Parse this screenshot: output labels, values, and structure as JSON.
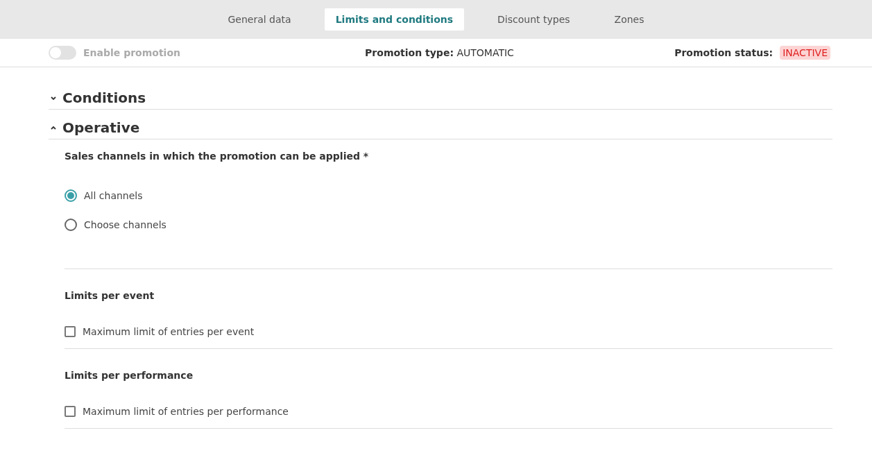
{
  "tabs": [
    {
      "label": "General data",
      "selected": false
    },
    {
      "label": "Limits and conditions",
      "selected": true
    },
    {
      "label": "Discount types",
      "selected": false
    },
    {
      "label": "Zones",
      "selected": false
    }
  ],
  "status_bar": {
    "toggle": {
      "label": "Enable promotion",
      "on": false,
      "disabled": true
    },
    "type_label": "Promotion type:",
    "type_value": "AUTOMATIC",
    "status_label": "Promotion status:",
    "status_value": "INACTIVE"
  },
  "sections": [
    {
      "title": "Conditions",
      "expanded": false
    },
    {
      "title": "Operative",
      "expanded": true
    }
  ],
  "operative": {
    "channels_question": "Sales channels in which the promotion can be applied *",
    "channel_options": [
      {
        "label": "All channels",
        "selected": true
      },
      {
        "label": "Choose channels",
        "selected": false
      }
    ],
    "limit_groups": [
      {
        "title": "Limits per event",
        "option": {
          "label": "Maximum limit of entries per event",
          "checked": false
        }
      },
      {
        "title": "Limits per performance",
        "option": {
          "label": "Maximum limit of entries per performance",
          "checked": false
        }
      }
    ]
  }
}
